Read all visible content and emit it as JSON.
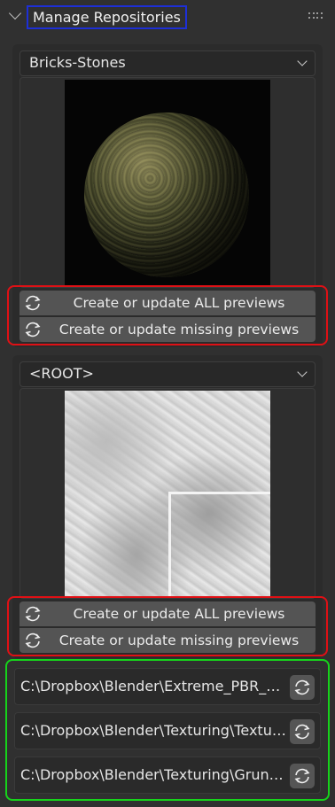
{
  "header": {
    "title": "Manage Repositories",
    "collapse_icon": "chevron-down-icon",
    "grip_icon": "drag-grip-icon"
  },
  "repositories": [
    {
      "selected": "Bricks-Stones",
      "preview": "stone-sphere-preview",
      "buttons": {
        "all": "Create or update ALL previews",
        "missing": "Create or update missing previews"
      }
    },
    {
      "selected": "<ROOT>",
      "preview": "concrete-texture-preview",
      "buttons": {
        "all": "Create or update ALL previews",
        "missing": "Create or update missing previews"
      }
    }
  ],
  "paths": [
    "C:\\Dropbox\\Blender\\Extreme_PBR_LIB\\",
    "C:\\Dropbox\\Blender\\Texturing\\Textur...",
    "C:\\Dropbox\\Blender\\Texturing\\Grung..."
  ],
  "colors": {
    "highlight_title": "#1d2fd6",
    "highlight_buttons": "#e01015",
    "highlight_paths": "#16d31b"
  }
}
